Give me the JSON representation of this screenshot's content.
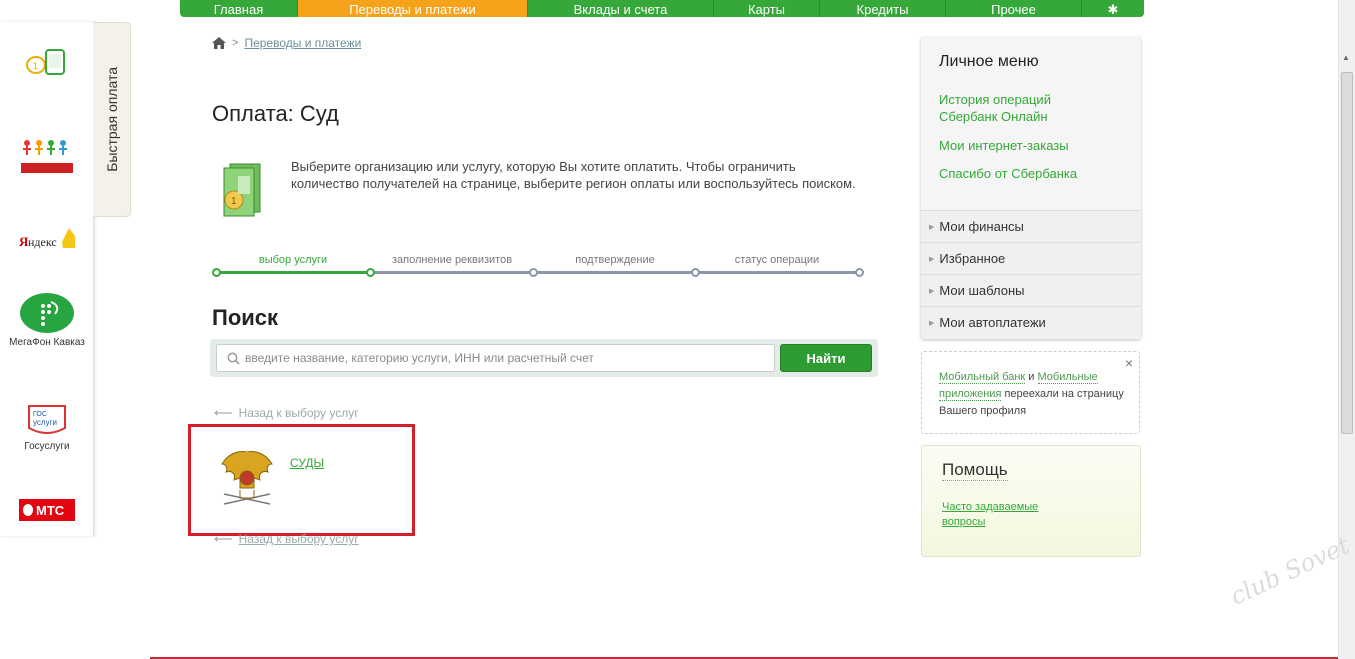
{
  "top_nav": {
    "tabs": [
      {
        "label": "Главная",
        "active": false
      },
      {
        "label": "Переводы и платежи",
        "active": true
      },
      {
        "label": "Вклады и счета",
        "active": false
      },
      {
        "label": "Карты",
        "active": false
      },
      {
        "label": "Кредиты",
        "active": false
      },
      {
        "label": "Прочее",
        "active": false
      }
    ],
    "settings_icon": "gear-icon"
  },
  "quick_pay": {
    "tab_label": "Быстрая оплата",
    "items": [
      {
        "icon": "mobile-payment-icon",
        "label": ""
      },
      {
        "icon": "charity-logo-icon",
        "label": ""
      },
      {
        "icon": "yandex-logo-icon",
        "label": ""
      },
      {
        "icon": "megafon-logo-icon",
        "label": "МегаФон Кавказ"
      },
      {
        "icon": "gosuslugi-logo-icon",
        "label": "Госуслуги"
      },
      {
        "icon": "mts-logo-icon",
        "label": "МТС"
      }
    ]
  },
  "breadcrumb": {
    "home_icon": "home-icon",
    "item": "Переводы и платежи"
  },
  "page": {
    "title": "Оплата: Суд",
    "intro": "Выберите организацию или услугу, которую Вы хотите оплатить. Чтобы ограничить количество получателей на странице, выберите регион оплаты или воспользуйтесь поиском."
  },
  "stepper": {
    "steps": [
      "выбор услуги",
      "заполнение реквизитов",
      "подтверждение",
      "статус операции"
    ],
    "current": 1
  },
  "search": {
    "title": "Поиск",
    "placeholder": "введите название, категорию услуги, ИНН или расчетный счет",
    "button": "Найти"
  },
  "results": {
    "back_label": "Назад к выбору услуг",
    "items": [
      {
        "label": "СУДЫ",
        "icon": "coat-of-arms-icon"
      }
    ]
  },
  "personal_menu": {
    "title": "Личное меню",
    "links": [
      "История операций Сбербанк Онлайн",
      "Мои интернет-заказы",
      "Спасибо от Сбербанка"
    ],
    "sections": [
      "Мои финансы",
      "Избранное",
      "Мои шаблоны",
      "Мои автоплатежи"
    ]
  },
  "notice": {
    "link1": "Мобильный банк",
    "and": " и ",
    "link2": "Мобильные приложения",
    "rest": " переехали на страницу Вашего профиля",
    "close": "×"
  },
  "help": {
    "title": "Помощь",
    "link": "Часто задаваемые вопросы"
  },
  "watermark": "club Sovet",
  "colors": {
    "brand_green": "#35a839",
    "accent_orange": "#f7a21b",
    "highlight_red": "#d3202a"
  }
}
